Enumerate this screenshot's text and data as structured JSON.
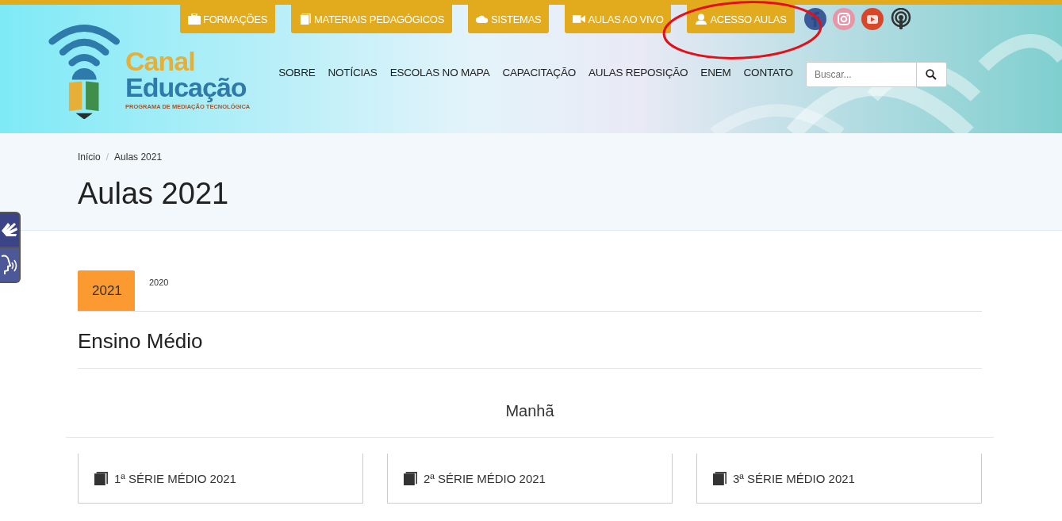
{
  "top_links": [
    {
      "label": "FORMAÇÕES",
      "kind": "briefcase"
    },
    {
      "label": "MATERIAIS PEDAGÓGICOS",
      "kind": "book"
    },
    {
      "label": "SISTEMAS",
      "kind": "cloud"
    },
    {
      "label": "AULAS AO VIVO",
      "kind": "camera"
    },
    {
      "label": "ACESSO AULAS",
      "kind": "user"
    }
  ],
  "logo": {
    "line_1": "Canal",
    "line_2": "Educação",
    "tagline": "PROGRAMA DE MEDIAÇÃO TECNOLÓGICA"
  },
  "nav": [
    "SOBRE",
    "NOTÍCIAS",
    "ESCOLAS NO MAPA",
    "CAPACITAÇÃO",
    "AULAS REPOSIÇÃO",
    "ENEM",
    "CONTATO"
  ],
  "search": {
    "placeholder": "Buscar..."
  },
  "breadcrumb": [
    "Início",
    "Aulas 2021"
  ],
  "breadcrumb_separator": "/",
  "page_title": "Aulas 2021",
  "tabs": [
    {
      "label": "2021",
      "selected": true
    },
    {
      "label": "2020",
      "selected": false
    }
  ],
  "section_title": "Ensino Médio",
  "shift_title": "Manhã",
  "cards": [
    "1ª SÉRIE MÉDIO 2021",
    "2ª SÉRIE MÉDIO 2021",
    "3ª SÉRIE MÉDIO 2021"
  ]
}
